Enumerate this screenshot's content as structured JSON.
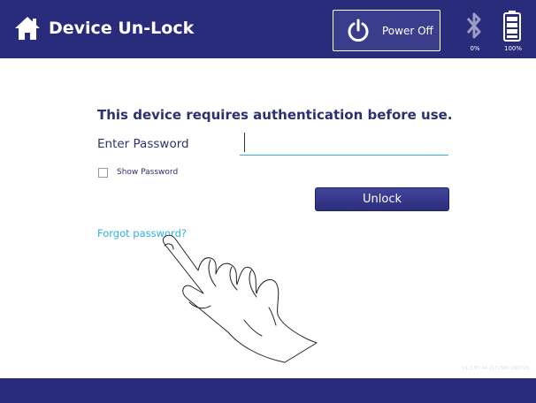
{
  "header": {
    "title": "Device Un-Lock",
    "power_label": "Power Off",
    "bluetooth_level": "0%",
    "battery_level": "100%",
    "home_icon": "home-icon",
    "power_icon": "power-icon",
    "bluetooth_icon": "bluetooth-icon",
    "battery_icon": "battery-icon"
  },
  "form": {
    "prompt": "This device requires authentication before use.",
    "password_label": "Enter Password",
    "password_value": "",
    "show_password_label": "Show Password",
    "show_password_checked": false,
    "unlock_label": "Unlock",
    "forgot_label": "Forgot password?"
  },
  "footer": {
    "version": "v1.3.97.44 (17256) 190723"
  },
  "overlay": {
    "hand_icon": "pointing-hand-icon"
  },
  "colors": {
    "header_bg": "#292c7b",
    "accent": "#2fb0e0",
    "text_primary": "#2d3070"
  }
}
